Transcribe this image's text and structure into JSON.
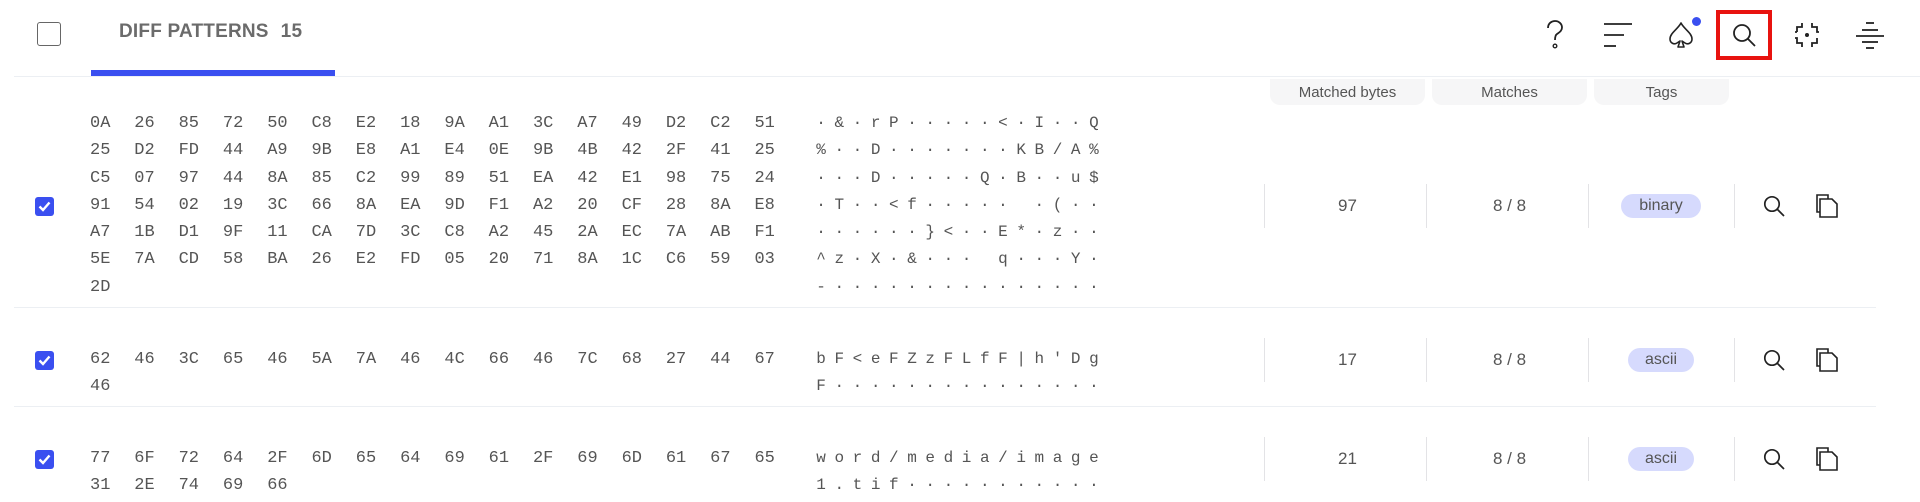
{
  "header": {
    "select_all_checked": false,
    "tab": {
      "label": "DIFF PATTERNS",
      "count": "15",
      "active": true
    },
    "toolbar": [
      {
        "name": "help-icon",
        "label": "?"
      },
      {
        "name": "sort-icon",
        "label": ""
      },
      {
        "name": "spade-icon",
        "label": "",
        "notification": true
      },
      {
        "name": "search-icon",
        "label": "",
        "highlighted": true
      },
      {
        "name": "focus-icon",
        "label": ""
      },
      {
        "name": "divide-icon",
        "label": ""
      }
    ],
    "accent_color": "#3a4ff0",
    "highlight_color": "#e8130f"
  },
  "columns": {
    "matched_bytes": "Matched bytes",
    "matches": "Matches",
    "tags": "Tags"
  },
  "rows": [
    {
      "checked": true,
      "hex": [
        [
          "0A",
          "26",
          "85",
          "72",
          "50",
          "C8",
          "E2",
          "18",
          "9A",
          "A1",
          "3C",
          "A7",
          "49",
          "D2",
          "C2",
          "51"
        ],
        [
          "25",
          "D2",
          "FD",
          "44",
          "A9",
          "9B",
          "E8",
          "A1",
          "E4",
          "0E",
          "9B",
          "4B",
          "42",
          "2F",
          "41",
          "25"
        ],
        [
          "C5",
          "07",
          "97",
          "44",
          "8A",
          "85",
          "C2",
          "99",
          "89",
          "51",
          "EA",
          "42",
          "E1",
          "98",
          "75",
          "24"
        ],
        [
          "91",
          "54",
          "02",
          "19",
          "3C",
          "66",
          "8A",
          "EA",
          "9D",
          "F1",
          "A2",
          "20",
          "CF",
          "28",
          "8A",
          "E8"
        ],
        [
          "A7",
          "1B",
          "D1",
          "9F",
          "11",
          "CA",
          "7D",
          "3C",
          "C8",
          "A2",
          "45",
          "2A",
          "EC",
          "7A",
          "AB",
          "F1"
        ],
        [
          "5E",
          "7A",
          "CD",
          "58",
          "BA",
          "26",
          "E2",
          "FD",
          "05",
          "20",
          "71",
          "8A",
          "1C",
          "C6",
          "59",
          "03"
        ],
        [
          "2D"
        ]
      ],
      "ascii": [
        "·&·rP·····<·I··Q",
        "%··D·······KB/A%",
        "···D·····Q·B··u$",
        "·T··<f····· ·(··",
        "······}<··E*·z··",
        "^z·X·&··· q···Y·",
        "-···············"
      ],
      "matched_bytes": "97",
      "matches": "8 / 8",
      "tag": "binary"
    },
    {
      "checked": true,
      "hex": [
        [
          "62",
          "46",
          "3C",
          "65",
          "46",
          "5A",
          "7A",
          "46",
          "4C",
          "66",
          "46",
          "7C",
          "68",
          "27",
          "44",
          "67"
        ],
        [
          "46"
        ]
      ],
      "ascii": [
        "bF<eFZzFLfF|h'Dg",
        "F···············"
      ],
      "matched_bytes": "17",
      "matches": "8 / 8",
      "tag": "ascii"
    },
    {
      "checked": true,
      "hex": [
        [
          "77",
          "6F",
          "72",
          "64",
          "2F",
          "6D",
          "65",
          "64",
          "69",
          "61",
          "2F",
          "69",
          "6D",
          "61",
          "67",
          "65"
        ],
        [
          "31",
          "2E",
          "74",
          "69",
          "66"
        ]
      ],
      "ascii": [
        "word/media/image",
        "1.tif···········"
      ],
      "matched_bytes": "21",
      "matches": "8 / 8",
      "tag": "ascii"
    }
  ],
  "row_actions": {
    "inspect": "search-icon",
    "copy": "copy-icon"
  }
}
